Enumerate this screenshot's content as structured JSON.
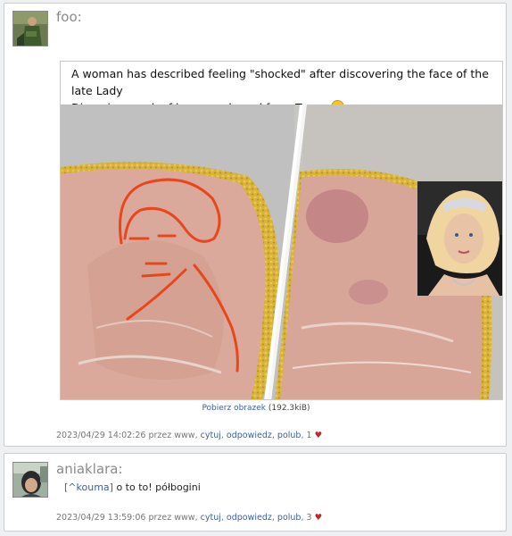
{
  "posts": [
    {
      "author": "foo:",
      "image": {
        "caption_line1": "A woman has described feeling \"shocked\" after discovering the face of the late Lady",
        "caption_line2": "Diana in a pack of ham purchased from Tesco",
        "caption_emoji": "thinking-face-icon"
      },
      "download": {
        "link": "Pobierz obrazek",
        "size": "(192.3kiB)"
      },
      "meta": {
        "datetime": "2023/04/29 14:02:26",
        "by": "przez www,",
        "quote": "cytuj",
        "reply": "odpowiedz",
        "like": "polub",
        "likes": "1",
        "heart": "♥"
      }
    },
    {
      "author": "aniaklara:",
      "body": {
        "mention": "[^kouma]",
        "text": "o to to! półbogini"
      },
      "meta": {
        "datetime": "2023/04/29 13:59:06",
        "by": "przez www,",
        "quote": "cytuj",
        "reply": "odpowiedz",
        "like": "polub",
        "likes": "3",
        "heart": "♥"
      }
    }
  ],
  "colors": {
    "link": "#3b5fa8",
    "heart": "#c0262e",
    "author": "#8a8a8a",
    "drawing": "#e8471e"
  }
}
